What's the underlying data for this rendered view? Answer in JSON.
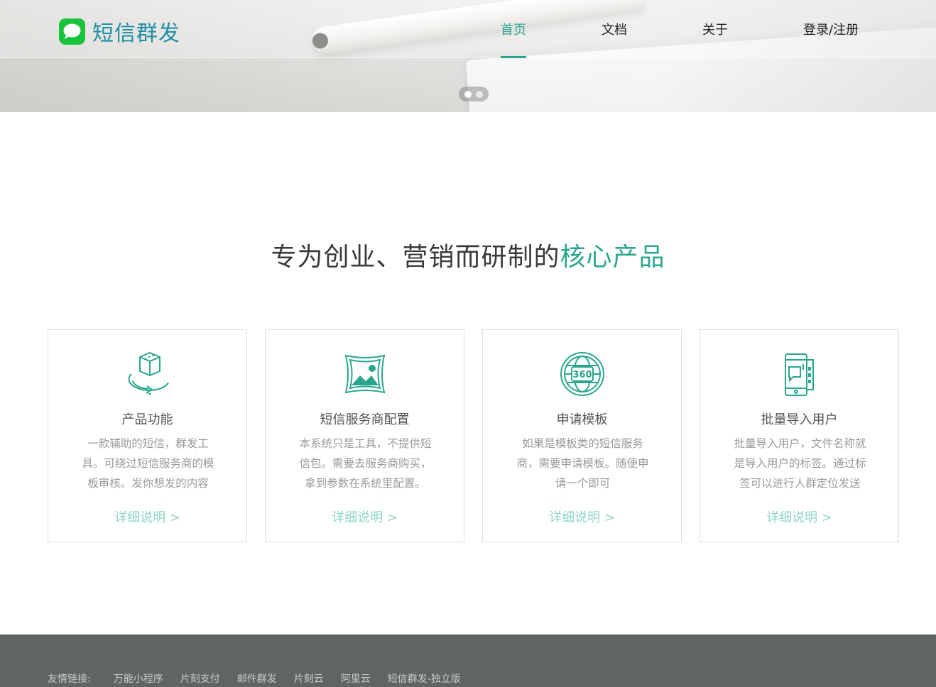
{
  "header": {
    "logo_text": "短信群发",
    "nav": [
      {
        "label": "首页",
        "active": true
      },
      {
        "label": "文档",
        "active": false
      },
      {
        "label": "关于",
        "active": false
      },
      {
        "label": "登录/注册",
        "active": false
      }
    ],
    "carousel": {
      "slides": 2,
      "current": 1
    }
  },
  "main": {
    "headline_part1": "专为创业、营销而研制的",
    "headline_highlight": "核心产品",
    "cards": [
      {
        "icon": "3d-cube-rotate-icon",
        "title": "产品功能",
        "desc": "一款辅助的短信，群发工具。可绕过短信服务商的模板审核。发你想发的内容",
        "more": "详细说明 >"
      },
      {
        "icon": "panorama-image-icon",
        "title": "短信服务商配置",
        "desc": "本系统只是工具，不提供短信包。需要去服务商购买，拿到参数在系统里配置。",
        "more": "详细说明 >"
      },
      {
        "icon": "globe-360-icon",
        "title": "申请模板",
        "desc": "如果是模板类的短信服务商，需要申请模板。随便申请一个即可",
        "more": "详细说明 >"
      },
      {
        "icon": "phone-message-icon",
        "title": "批量导入用户",
        "desc": "批量导入用户，文件名称就是导入用户的标签。通过标签可以进行人群定位发送",
        "more": "详细说明 >"
      }
    ]
  },
  "footer": {
    "links_label": "友情链接:",
    "links": [
      "万能小程序",
      "片刻支付",
      "邮件群发",
      "片刻云",
      "阿里云",
      "短信群发-独立版"
    ]
  },
  "colors": {
    "accent": "#2aa68f",
    "logo_green": "#19c33a",
    "logo_text": "#1f8fa3",
    "footer_bg": "#5f6562"
  }
}
